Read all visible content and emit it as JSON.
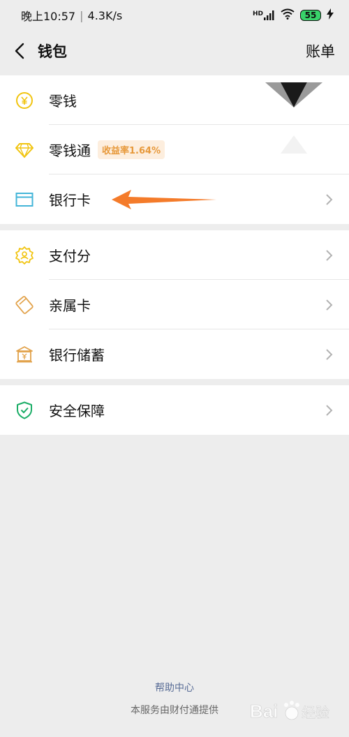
{
  "status": {
    "time": "晚上10:57",
    "speed": "4.3K/s",
    "network": "HD",
    "battery": "55"
  },
  "nav": {
    "title": "钱包",
    "right": "账单"
  },
  "groups": [
    {
      "items": [
        {
          "label": "零钱",
          "icon": "yuan-coin-icon"
        },
        {
          "label": "零钱通",
          "icon": "diamond-icon",
          "badge": "收益率1.64%"
        },
        {
          "label": "银行卡",
          "icon": "bank-card-icon"
        }
      ]
    },
    {
      "items": [
        {
          "label": "支付分",
          "icon": "payment-score-icon"
        },
        {
          "label": "亲属卡",
          "icon": "family-card-icon"
        },
        {
          "label": "银行储蓄",
          "icon": "bank-savings-icon"
        }
      ]
    },
    {
      "items": [
        {
          "label": "安全保障",
          "icon": "shield-icon"
        }
      ]
    }
  ],
  "footer": {
    "help": "帮助中心",
    "note": "本服务由财付通提供"
  },
  "watermark": {
    "text": "Bai 经验"
  },
  "colors": {
    "accent_yellow": "#f1c40f",
    "arrow": "#f47b2a",
    "card_blue": "#43b5d8",
    "shield_green": "#1aad66",
    "link": "#576b95"
  }
}
